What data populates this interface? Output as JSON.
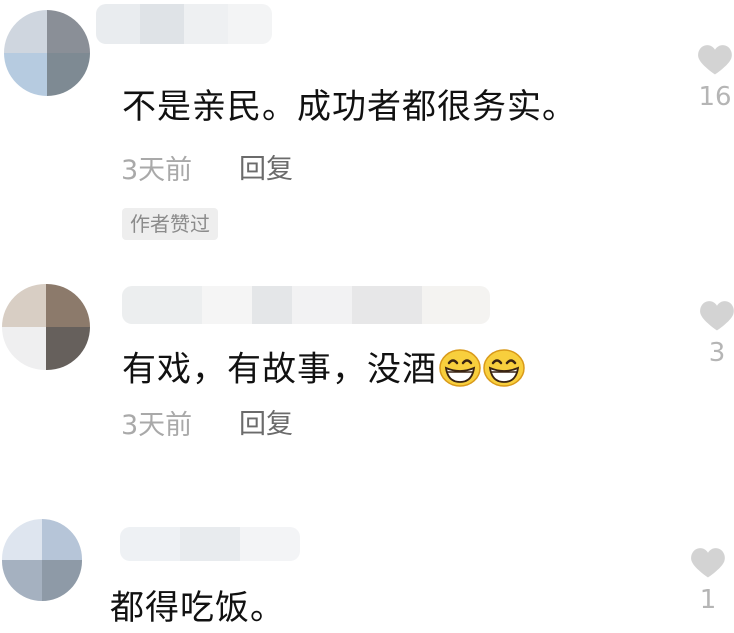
{
  "comments": [
    {
      "text": "不是亲民。成功者都很务实。",
      "time": "3天前",
      "reply_label": "回复",
      "author_badge": "作者赞过",
      "likes": "16"
    },
    {
      "text": "有戏，有故事，没酒",
      "emoji": [
        "grinning-face-emoji",
        "grinning-face-emoji"
      ],
      "time": "3天前",
      "reply_label": "回复",
      "likes": "3"
    },
    {
      "text": "都得吃饭。",
      "likes": "1"
    }
  ],
  "colors": {
    "like_icon": "#d3d3d3",
    "time_text": "#a9a9a9",
    "reply_text": "#6b6b6b",
    "badge_bg": "#eeeeee"
  }
}
